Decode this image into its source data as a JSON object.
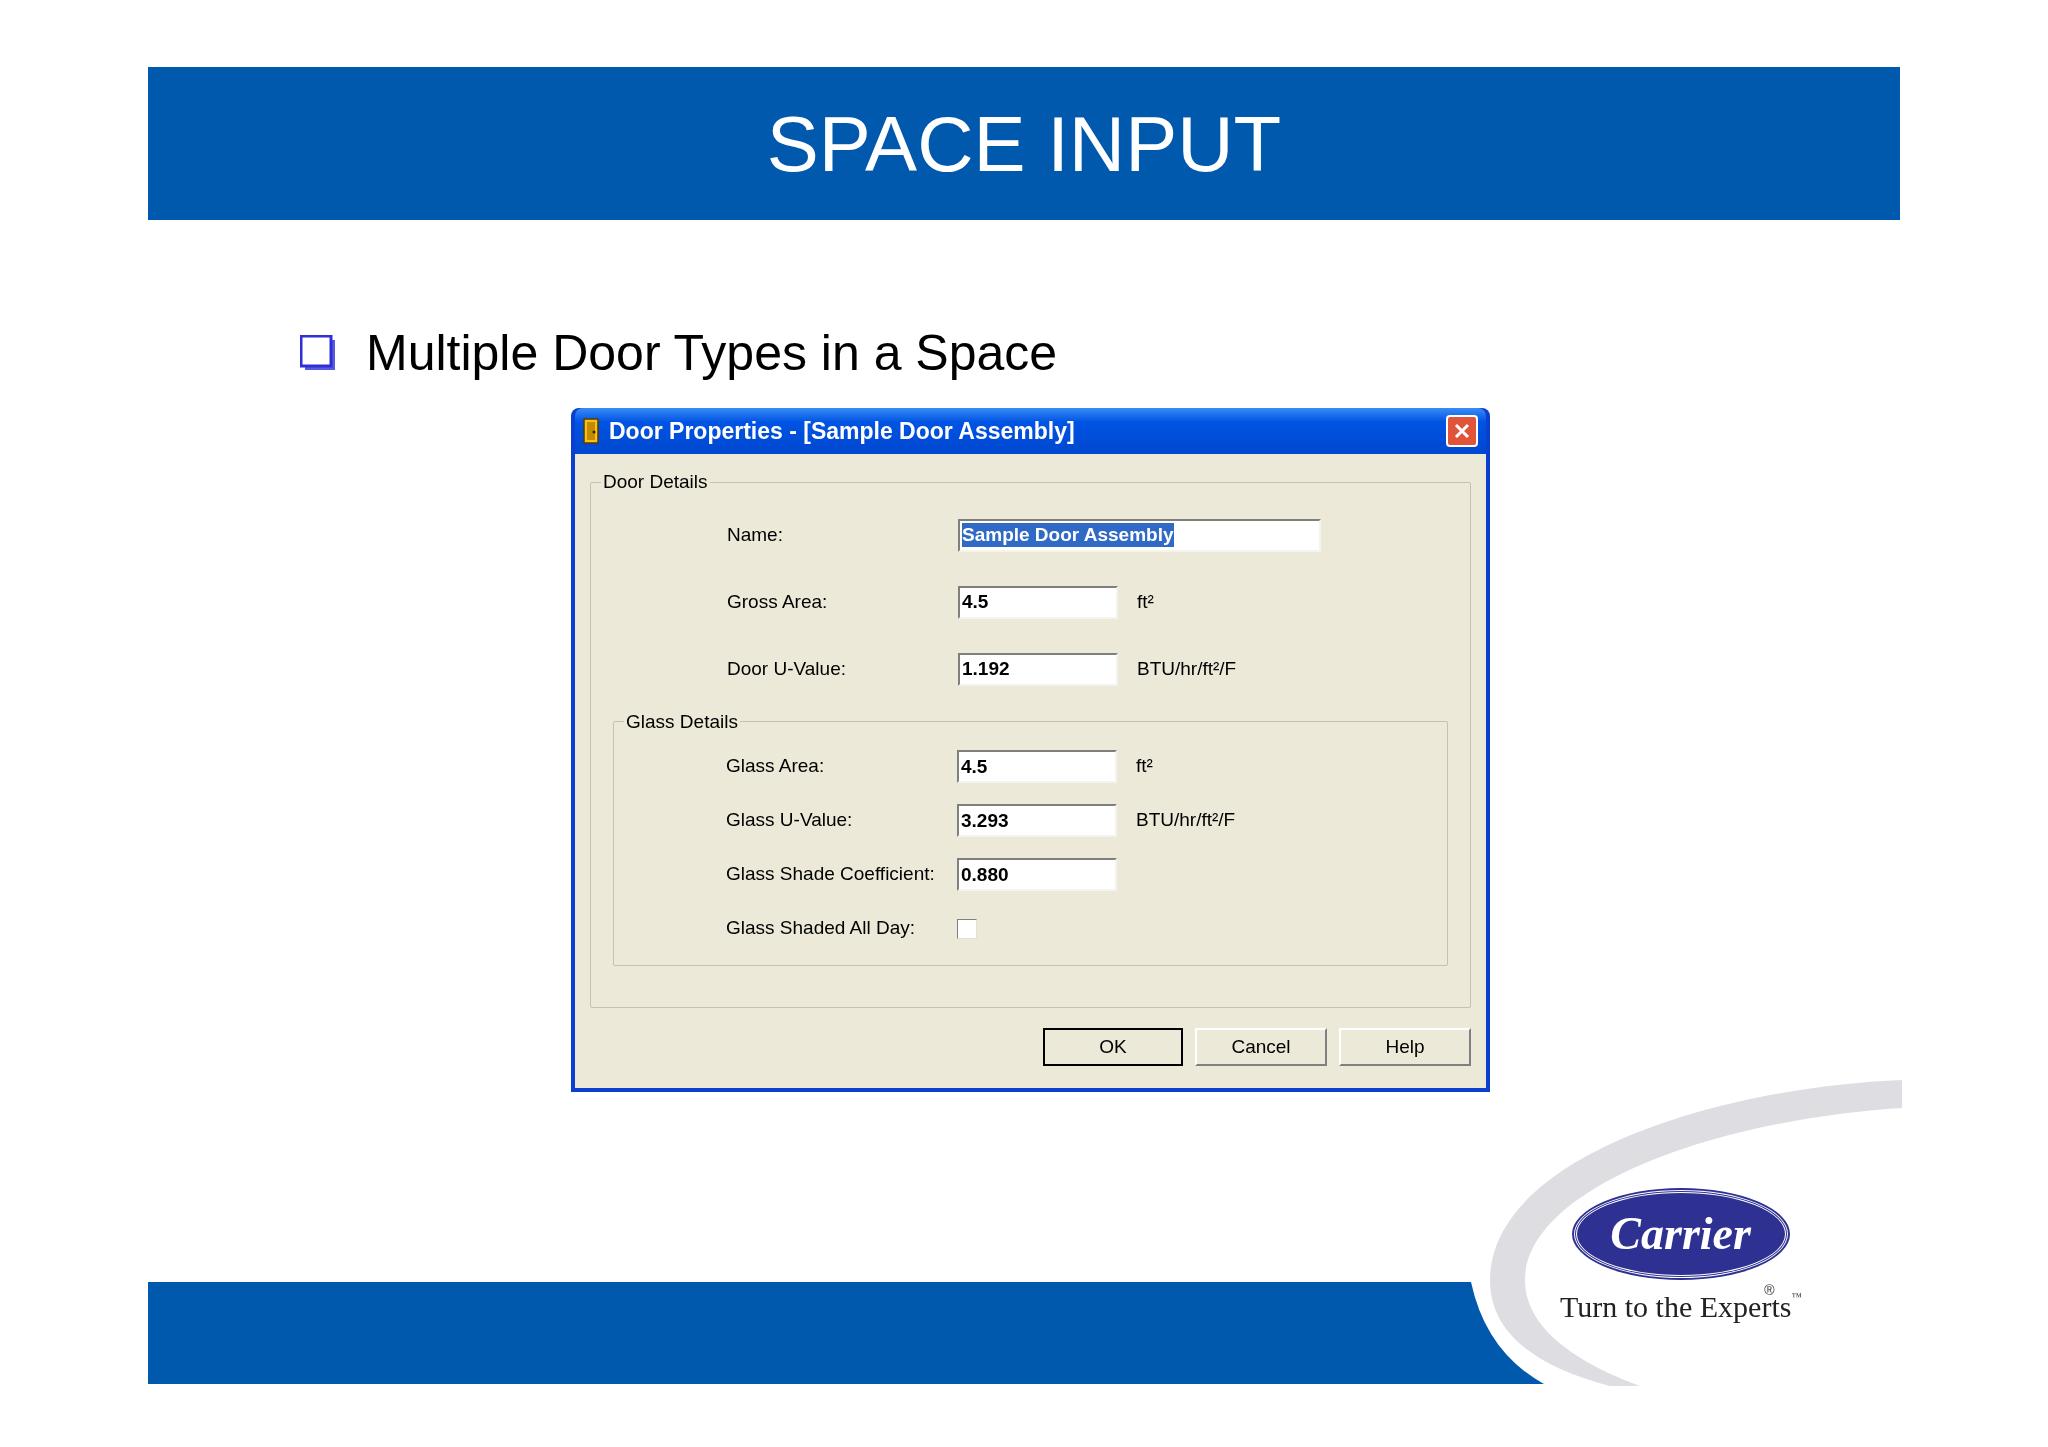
{
  "slide": {
    "title": "SPACE INPUT",
    "bullet": "Multiple Door Types in a Space"
  },
  "dialog": {
    "title": "Door Properties - [Sample Door Assembly]",
    "door_details": {
      "label": "Door Details",
      "fields": [
        {
          "kind": "wide",
          "label": "Name:",
          "value": "Sample Door Assembly",
          "selected": true
        },
        {
          "kind": "text",
          "label": "Gross Area:",
          "value": "4.5",
          "unit": "ft²",
          "selected": false
        },
        {
          "kind": "text",
          "label": "Door U-Value:",
          "value": "1.192",
          "unit": "BTU/hr/ft²/F",
          "selected": false
        }
      ]
    },
    "glass_details": {
      "label": "Glass Details",
      "fields": [
        {
          "kind": "text",
          "label": "Glass Area:",
          "value": "4.5",
          "unit": "ft²",
          "selected": false
        },
        {
          "kind": "text",
          "label": "Glass U-Value:",
          "value": "3.293",
          "unit": "BTU/hr/ft²/F",
          "selected": false
        },
        {
          "kind": "text",
          "label": "Glass Shade Coefficient:",
          "value": "0.880",
          "selected": false
        },
        {
          "kind": "checkbox",
          "label": "Glass Shaded All Day:",
          "checked": false
        }
      ]
    },
    "buttons": [
      {
        "label": "OK",
        "default": true
      },
      {
        "label": "Cancel",
        "default": false
      },
      {
        "label": "Help",
        "default": false
      }
    ]
  },
  "logo": {
    "name": "Carrier",
    "mark": "®",
    "tagline": "Turn to the Experts",
    "tagline_mark": "™"
  }
}
